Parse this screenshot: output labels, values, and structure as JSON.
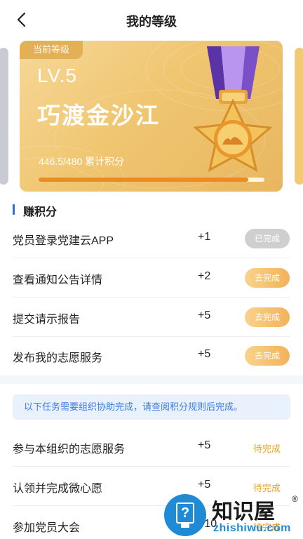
{
  "header": {
    "title": "我的等级",
    "back_icon": "chevron-left-icon"
  },
  "level_card": {
    "badge": "当前等级",
    "level": "LV.5",
    "level_name": "巧渡金沙江",
    "points_text": "446.5/480 累计积分",
    "progress": 0.93,
    "medal_icon": "star-medal-icon"
  },
  "earn_section": {
    "title": "赚积分",
    "tasks": [
      {
        "name": "党员登录党建云APP",
        "score": "+1",
        "action": "已完成",
        "state": "done"
      },
      {
        "name": "查看通知公告详情",
        "score": "+2",
        "action": "去完成",
        "state": "todo"
      },
      {
        "name": "提交请示报告",
        "score": "+5",
        "action": "去完成",
        "state": "todo"
      },
      {
        "name": "发布我的志愿服务",
        "score": "+5",
        "action": "去完成",
        "state": "todo"
      }
    ]
  },
  "org_section": {
    "notice": "以下任务需要组织协助完成，请查阅积分规则后完成。",
    "tasks": [
      {
        "name": "参与本组织的志愿服务",
        "score": "+5",
        "status": "待完成"
      },
      {
        "name": "认领并完成微心愿",
        "score": "+5",
        "status": "待完成"
      },
      {
        "name": "参加党员大会",
        "score": "+10",
        "status": "待完成"
      }
    ]
  },
  "watermark": {
    "text": "知识屋",
    "registered": "®",
    "url": "zhishiwu.com"
  },
  "colors": {
    "accent_blue": "#2d6ce8",
    "gold": "#f0c671",
    "orange": "#ee8a23",
    "pending": "#e9a526"
  }
}
